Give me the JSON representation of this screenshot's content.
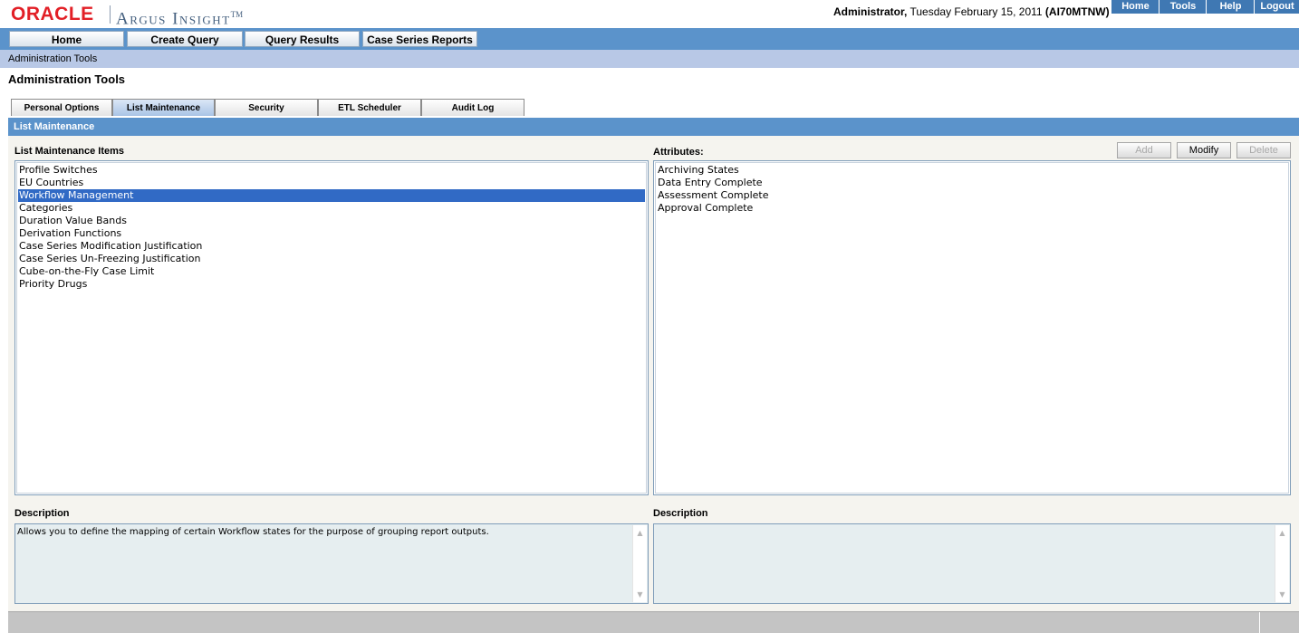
{
  "header": {
    "logo_oracle": "ORACLE",
    "logo_argus": "Argus Insight",
    "tm": "TM",
    "user": "Administrator,",
    "date": "Tuesday February 15, 2011",
    "host": "(AI70MTNW)"
  },
  "toplinks": [
    "Home",
    "Tools",
    "Help",
    "Logout"
  ],
  "nav": [
    "Home",
    "Create Query",
    "Query Results",
    "Case Series Reports"
  ],
  "breadcrumb": "Administration Tools",
  "page_title": "Administration Tools",
  "tabs": [
    "Personal Options",
    "List Maintenance",
    "Security",
    "ETL Scheduler",
    "Audit Log"
  ],
  "active_tab": "List Maintenance",
  "section_title": "List Maintenance",
  "left": {
    "label": "List Maintenance Items",
    "items": [
      "Profile Switches",
      "EU Countries",
      "Workflow Management",
      "Categories",
      "Duration Value Bands",
      "Derivation Functions",
      "Case Series Modification Justification",
      "Case Series Un-Freezing Justification",
      "Cube-on-the-Fly Case Limit",
      "Priority Drugs"
    ],
    "selected": "Workflow Management",
    "desc_label": "Description",
    "description": "Allows you to define the mapping of certain Workflow states for the purpose of grouping report outputs."
  },
  "right": {
    "label": "Attributes:",
    "buttons": {
      "add": "Add",
      "modify": "Modify",
      "delete": "Delete"
    },
    "items": [
      "Archiving States",
      "Data Entry Complete",
      "Assessment Complete",
      "Approval Complete"
    ],
    "desc_label": "Description",
    "description": ""
  },
  "colors": {
    "brand_red": "#e21f26",
    "nav_blue": "#5b93cb",
    "selection": "#316ac5"
  }
}
